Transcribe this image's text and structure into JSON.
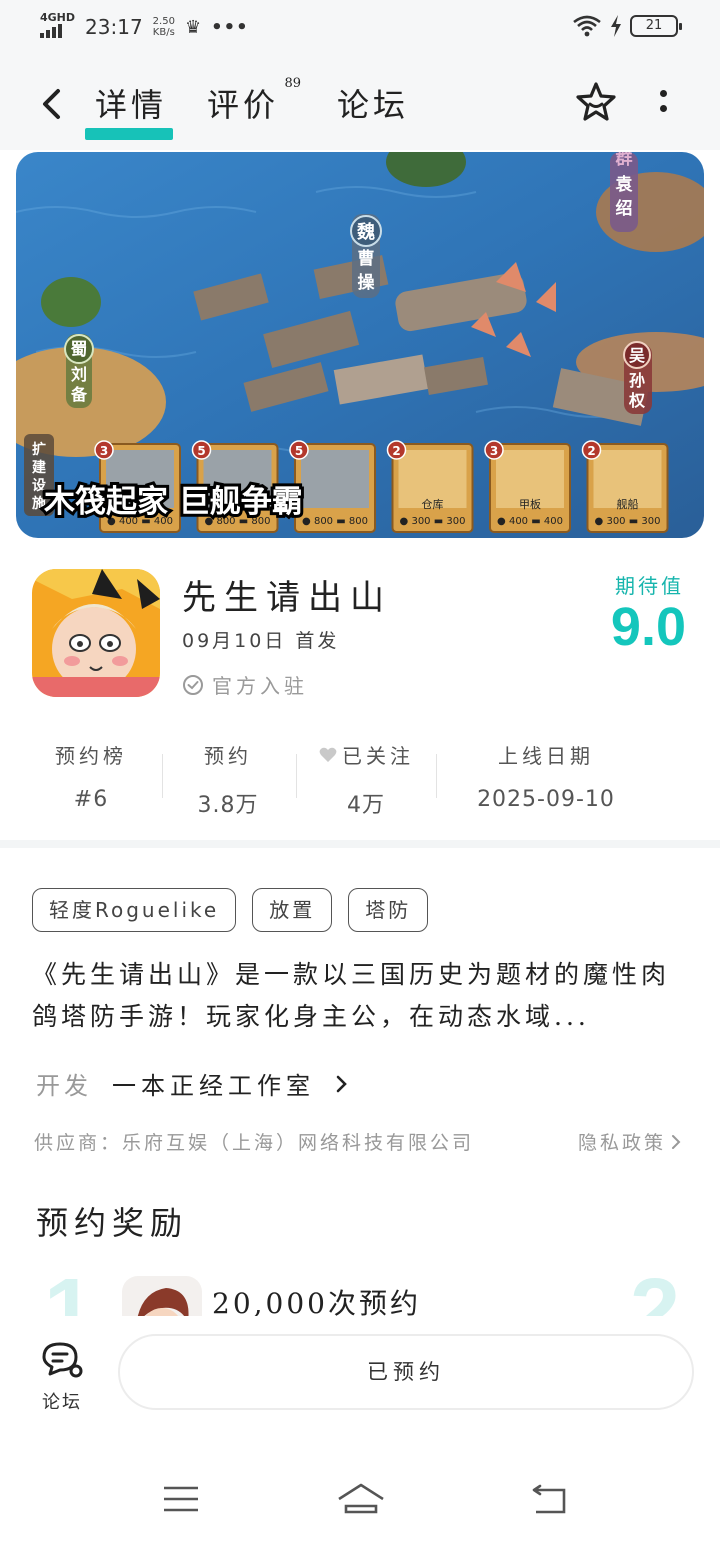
{
  "status_bar": {
    "network": "4GHD",
    "time": "23:17",
    "speed_value": "2.50",
    "speed_unit": "KB/s",
    "battery": "21"
  },
  "header": {
    "tabs": [
      {
        "label": "详情",
        "active": true
      },
      {
        "label": "评价",
        "badge": "89"
      },
      {
        "label": "论坛"
      }
    ]
  },
  "banner": {
    "faction_wei": "魏",
    "leader_wei": "曹操",
    "faction_shu": "蜀",
    "leader_shu": "刘备",
    "faction_wu": "吴",
    "leader_wu": "孙权",
    "faction_qun": "群",
    "leader_qun": "袁绍",
    "side_label": "扩建设施",
    "slogan": "木筏起家 巨舰争霸",
    "cards": [
      {
        "level": "3",
        "name": "",
        "cost": [
          "400",
          "400"
        ]
      },
      {
        "level": "5",
        "name": "",
        "cost": [
          "800",
          "800"
        ]
      },
      {
        "level": "5",
        "name": "",
        "cost": [
          "800",
          "800"
        ]
      },
      {
        "level": "2",
        "name": "仓库",
        "cost": [
          "300",
          "300"
        ]
      },
      {
        "level": "3",
        "name": "甲板",
        "cost": [
          "400",
          "400"
        ]
      },
      {
        "level": "2",
        "name": "舰船",
        "cost": [
          "300",
          "300"
        ]
      }
    ]
  },
  "app": {
    "title": "先生请出山",
    "release": "09月10日 首发",
    "verified": "官方入驻",
    "expect_label": "期待值",
    "expect_value": "9.0"
  },
  "stats": [
    {
      "label": "预约榜",
      "value": "#6"
    },
    {
      "label": "预约",
      "value": "3.8万"
    },
    {
      "label": "已关注",
      "value": "4万"
    },
    {
      "label": "上线日期",
      "value": "2025-09-10"
    }
  ],
  "tags": [
    "轻度Roguelike",
    "放置",
    "塔防"
  ],
  "description": "《先生请出山》是一款以三国历史为题材的魔性肉鸽塔防手游！玩家化身主公，在动态水域...",
  "developer": {
    "label": "开发",
    "name": "一本正经工作室"
  },
  "supplier": "供应商：乐府互娱（上海）网络科技有限公司",
  "privacy": "隐私政策",
  "rewards": {
    "title": "预约奖励",
    "items": [
      {
        "rank": "1",
        "text": "20,000次预约"
      },
      {
        "rank": "2",
        "text": ""
      }
    ]
  },
  "bottom": {
    "forum_label": "论坛",
    "reserve_button": "已预约"
  },
  "colors": {
    "accent": "#17c2b8",
    "expect": "#14c6bc"
  }
}
